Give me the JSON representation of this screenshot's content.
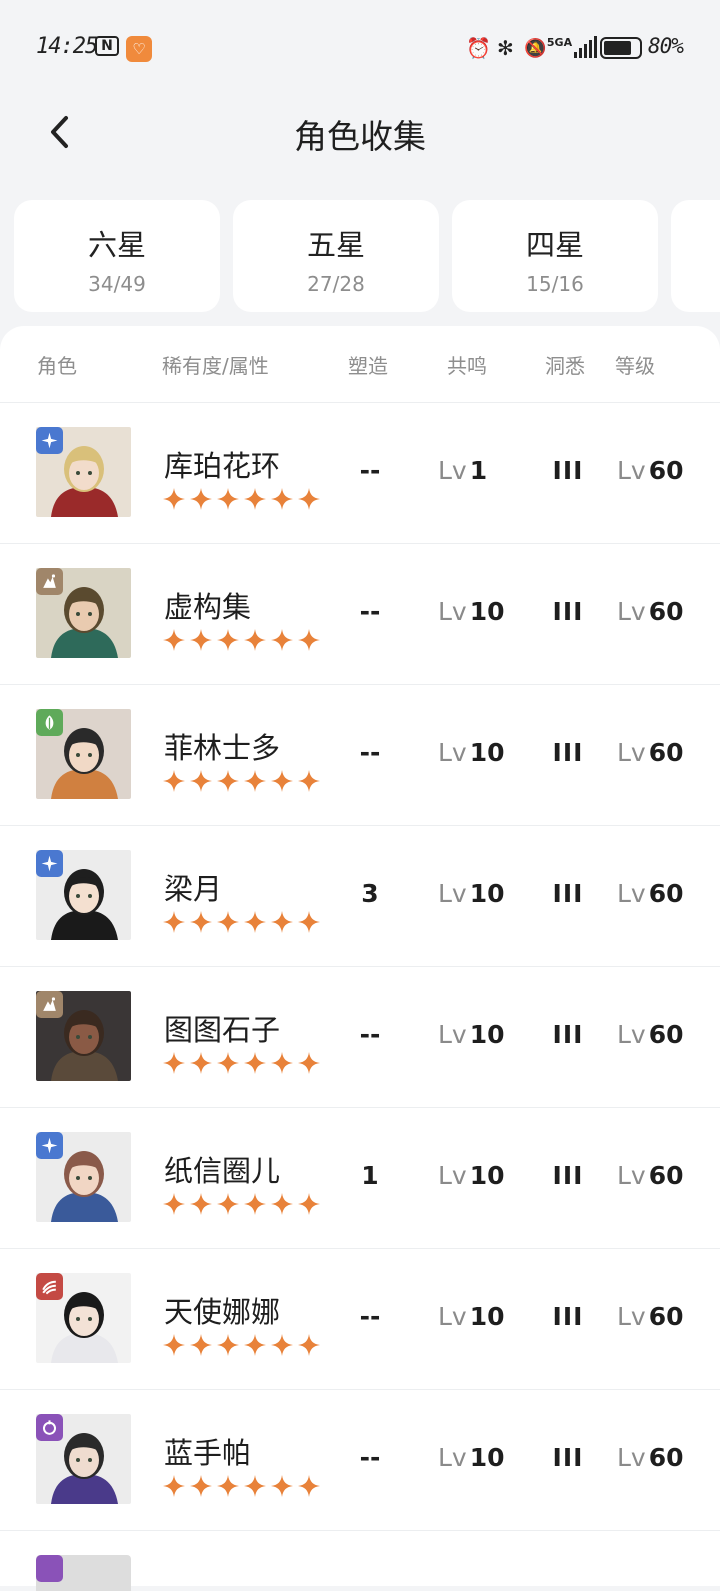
{
  "status_bar": {
    "time": "14:25",
    "signal": "5GA",
    "battery": "80%",
    "battery_level": 0.8
  },
  "header": {
    "title": "角色收集"
  },
  "tabs": [
    {
      "label": "六星",
      "count": "34/49"
    },
    {
      "label": "五星",
      "count": "27/28"
    },
    {
      "label": "四星",
      "count": "15/16"
    },
    {
      "label": "",
      "count": ""
    }
  ],
  "table": {
    "columns": {
      "role": "角色",
      "rarity": "稀有度/属性",
      "forge": "塑造",
      "resonance": "共鸣",
      "insight": "洞悉",
      "level": "等级"
    },
    "lv_prefix": "Lv",
    "rows": [
      {
        "name": "库珀花环",
        "stars": 6,
        "element": "star",
        "element_color": "#4a78d0",
        "forge": "--",
        "resonance": "1",
        "insight": "III",
        "level": "60"
      },
      {
        "name": "虚构集",
        "stars": 6,
        "element": "beast",
        "element_color": "#a0866a",
        "forge": "--",
        "resonance": "10",
        "insight": "III",
        "level": "60"
      },
      {
        "name": "菲林士多",
        "stars": 6,
        "element": "plant",
        "element_color": "#5faa5a",
        "forge": "--",
        "resonance": "10",
        "insight": "III",
        "level": "60"
      },
      {
        "name": "梁月",
        "stars": 6,
        "element": "star",
        "element_color": "#4a78d0",
        "forge": "3",
        "resonance": "10",
        "insight": "III",
        "level": "60"
      },
      {
        "name": "图图石子",
        "stars": 6,
        "element": "beast",
        "element_color": "#a0866a",
        "forge": "--",
        "resonance": "10",
        "insight": "III",
        "level": "60"
      },
      {
        "name": "纸信圈儿",
        "stars": 6,
        "element": "star",
        "element_color": "#4a78d0",
        "forge": "1",
        "resonance": "10",
        "insight": "III",
        "level": "60"
      },
      {
        "name": "天使娜娜",
        "stars": 6,
        "element": "spirit",
        "element_color": "#c44a44",
        "forge": "--",
        "resonance": "10",
        "insight": "III",
        "level": "60"
      },
      {
        "name": "蓝手帕",
        "stars": 6,
        "element": "mineral",
        "element_color": "#8a52b8",
        "forge": "--",
        "resonance": "10",
        "insight": "III",
        "level": "60"
      }
    ]
  },
  "colors": {
    "star": "#e8823a",
    "background": "#f3f4f6",
    "card": "#ffffff"
  }
}
